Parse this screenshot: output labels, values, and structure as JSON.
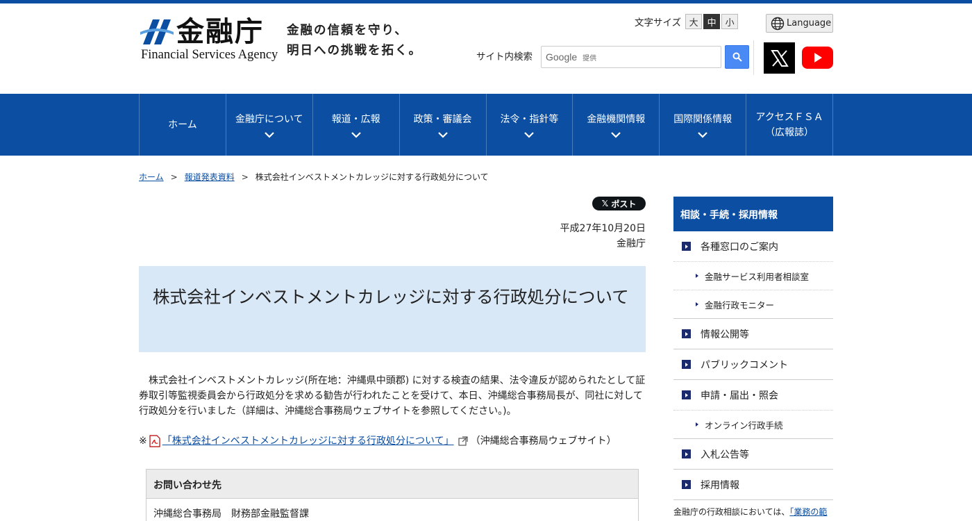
{
  "header": {
    "logo_jp": "金融庁",
    "logo_en": "Financial Services Agency",
    "slogan_line1": "金融の信頼を守り、",
    "slogan_line2": "明日への挑戦を拓く。",
    "fontsize_label": "文字サイズ",
    "fontsize_large": "大",
    "fontsize_medium": "中",
    "fontsize_small": "小",
    "language_label": "Language",
    "search_label": "サイト内検索",
    "search_google": "Google",
    "search_google_sub": "提供"
  },
  "nav": {
    "items": [
      {
        "label": "ホーム"
      },
      {
        "label": "金融庁について"
      },
      {
        "label": "報道・広報"
      },
      {
        "label": "政策・審議会"
      },
      {
        "label": "法令・指針等"
      },
      {
        "label": "金融機関情報"
      },
      {
        "label": "国際関係情報"
      },
      {
        "label": "アクセスＦＳＡ",
        "label2": "（広報誌）"
      }
    ]
  },
  "breadcrumb": {
    "home": "ホーム",
    "press": "報道発表資料",
    "current": "株式会社インベストメントカレッジに対する行政処分について"
  },
  "post_button": "ポスト",
  "date": "平成27年10月20日",
  "agency": "金融庁",
  "title": "株式会社インベストメントカレッジに対する行政処分について",
  "body": "株式会社インベストメントカレッジ(所在地：沖縄県中頭郡) に対する検査の結果、法令違反が認められたとして証券取引等監視委員会から行政処分を求める勧告が行われたことを受けて、本日、沖縄総合事務局長が、同社に対して行政処分を行いました（詳細は、沖縄総合事務局ウェブサイトを参照してください。)。",
  "note": {
    "prefix": "※",
    "link": "「株式会社インベストメントカレッジに対する行政処分について」",
    "suffix": "（沖縄総合事務局ウェブサイト）"
  },
  "contact": {
    "head": "お問い合わせ先",
    "body": "沖縄総合事務局　財務部金融監督課"
  },
  "sidebar": {
    "head": "相談・手続・採用情報",
    "items": [
      {
        "label": "各種窓口のご案内"
      },
      {
        "label": "金融サービス利用者相談室"
      },
      {
        "label": "金融行政モニター"
      },
      {
        "label": "情報公開等"
      },
      {
        "label": "パブリックコメント"
      },
      {
        "label": "申請・届出・照会"
      },
      {
        "label": "オンライン行政手続"
      },
      {
        "label": "入札公告等"
      },
      {
        "label": "採用情報"
      }
    ],
    "foot_text": "金融庁の行政相談においては、",
    "foot_link": "「業務の範"
  },
  "colors": {
    "brand": "#0c4ea2",
    "title_bg": "#d9e8f7"
  }
}
